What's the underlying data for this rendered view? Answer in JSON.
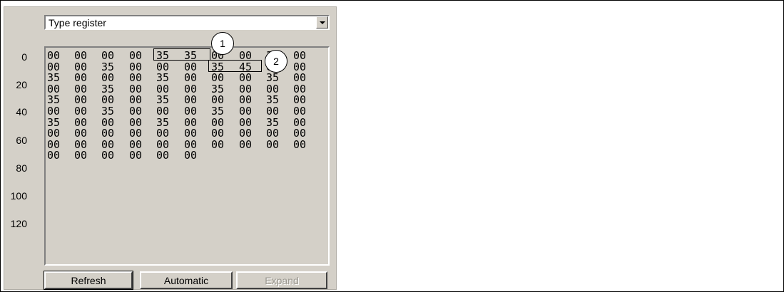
{
  "dropdown": {
    "value": "Type register"
  },
  "row_labels": [
    "0",
    "20",
    "40",
    "60",
    "80",
    "100",
    "120"
  ],
  "rows": [
    [
      "00",
      "00",
      "00",
      "00",
      "35",
      "35",
      "00",
      "00",
      "35",
      "00"
    ],
    [
      "00",
      "00",
      "35",
      "00",
      "00",
      "00",
      "35",
      "45",
      "00",
      "00"
    ],
    [
      "35",
      "00",
      "00",
      "00",
      "35",
      "00",
      "00",
      "00",
      "35",
      "00"
    ],
    [
      "00",
      "00",
      "35",
      "00",
      "00",
      "00",
      "35",
      "00",
      "00",
      "00"
    ],
    [
      "35",
      "00",
      "00",
      "00",
      "35",
      "00",
      "00",
      "00",
      "35",
      "00"
    ],
    [
      "00",
      "00",
      "35",
      "00",
      "00",
      "00",
      "35",
      "00",
      "00",
      "00"
    ],
    [
      "35",
      "00",
      "00",
      "00",
      "35",
      "00",
      "00",
      "00",
      "35",
      "00"
    ],
    [
      "00",
      "00",
      "00",
      "00",
      "00",
      "00",
      "00",
      "00",
      "00",
      "00"
    ],
    [
      "00",
      "00",
      "00",
      "00",
      "00",
      "00",
      "00",
      "00",
      "00",
      "00"
    ],
    [
      "00",
      "00",
      "00",
      "00",
      "00",
      "00"
    ]
  ],
  "callouts": [
    "1",
    "2"
  ],
  "buttons": {
    "refresh": "Refresh",
    "automatic": "Automatic",
    "expand": "Expand"
  }
}
